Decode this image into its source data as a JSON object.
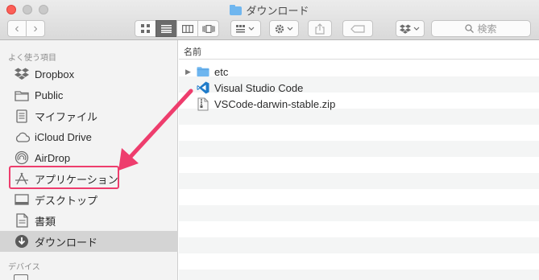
{
  "window": {
    "title": "ダウンロード"
  },
  "toolbar": {
    "back": "‹",
    "forward": "›",
    "search_placeholder": "検索"
  },
  "sidebar": {
    "favorites_header": "よく使う項目",
    "devices_header": "デバイス",
    "items": [
      {
        "label": "Dropbox",
        "icon": "dropbox-icon"
      },
      {
        "label": "Public",
        "icon": "folder-icon"
      },
      {
        "label": "マイファイル",
        "icon": "all-my-files-icon"
      },
      {
        "label": "iCloud Drive",
        "icon": "cloud-icon"
      },
      {
        "label": "AirDrop",
        "icon": "airdrop-icon"
      },
      {
        "label": "アプリケーション",
        "icon": "applications-icon"
      },
      {
        "label": "デスクトップ",
        "icon": "desktop-icon"
      },
      {
        "label": "書類",
        "icon": "document-icon"
      },
      {
        "label": "ダウンロード",
        "icon": "download-icon",
        "selected": true
      }
    ]
  },
  "list": {
    "column_name": "名前",
    "files": [
      {
        "name": "etc",
        "kind": "folder",
        "expandable": true
      },
      {
        "name": "Visual Studio Code",
        "kind": "app"
      },
      {
        "name": "VSCode-darwin-stable.zip",
        "kind": "zip"
      }
    ]
  },
  "annotation": {
    "color": "#ee3d6d"
  }
}
